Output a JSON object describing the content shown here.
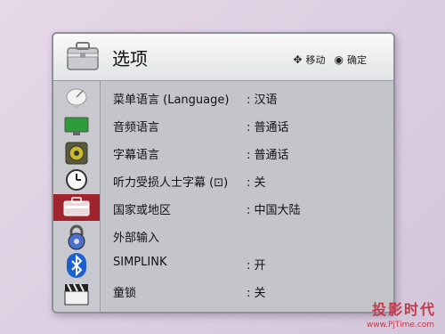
{
  "header": {
    "title": "选项",
    "hint_move": "移动",
    "hint_ok": "确定"
  },
  "sidebar": {
    "items": [
      {
        "icon": "satellite-dish-icon"
      },
      {
        "icon": "monitor-icon"
      },
      {
        "icon": "speaker-icon"
      },
      {
        "icon": "clock-icon"
      },
      {
        "icon": "options-icon",
        "active": true
      },
      {
        "icon": "lock-icon"
      },
      {
        "icon": "bluetooth-icon"
      },
      {
        "icon": "clapperboard-icon"
      }
    ]
  },
  "menu": {
    "rows": [
      {
        "label": "菜单语言 (Language)",
        "value": ": 汉语"
      },
      {
        "label": "音频语言",
        "value": ": 普通话"
      },
      {
        "label": "字幕语言",
        "value": ": 普通话"
      },
      {
        "label": "听力受损人士字幕 (⊡)",
        "value": ": 关"
      },
      {
        "label": "国家或地区",
        "value": ": 中国大陆"
      },
      {
        "label": "外部输入",
        "value": ""
      },
      {
        "label": "SIMPLINK",
        "value": ": 开"
      },
      {
        "label": "童锁",
        "value": ": 关"
      }
    ]
  },
  "watermark": {
    "brand": "投影时代",
    "url": "www.PjTime.com"
  },
  "colors": {
    "active_sidebar": "#a0242d",
    "panel_bg": "#c3c5cb"
  }
}
